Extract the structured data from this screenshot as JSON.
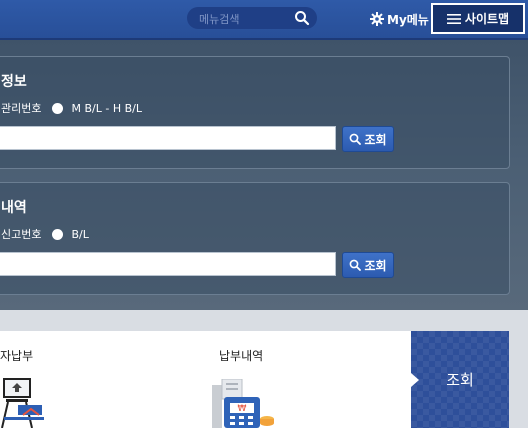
{
  "header": {
    "search_placeholder": "메뉴검색",
    "mymenu_label": "My메뉴",
    "sitemap_label": "사이트맵"
  },
  "panels": [
    {
      "title": "정보",
      "option_left": "관리번호",
      "option_right": "M B/L - H B/L",
      "input_value": "",
      "button_label": "조회"
    },
    {
      "title": "내역",
      "option_left": "신고번호",
      "option_right": "B/L",
      "input_value": "",
      "button_label": "조회"
    }
  ],
  "bottom": {
    "item1_label": "자납부",
    "item2_label": "납부내역",
    "query_label": "조회"
  },
  "colors": {
    "header_blue": "#2f5aa8",
    "button_blue": "#3566bd",
    "query_box": "#2e4f9a"
  }
}
